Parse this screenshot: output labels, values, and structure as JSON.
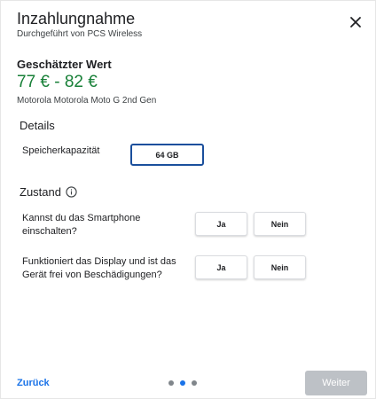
{
  "header": {
    "title": "Inzahlungnahme",
    "subtitle": "Durchgeführt von PCS Wireless"
  },
  "estimate": {
    "label": "Geschätzter Wert",
    "value": "77 € - 82 €",
    "device": "Motorola Motorola Moto G 2nd Gen"
  },
  "details": {
    "title": "Details",
    "storage_label": "Speicherkapazität",
    "storage_value": "64 GB"
  },
  "condition": {
    "title": "Zustand",
    "questions": [
      {
        "label": "Kannst du das Smartphone einschalten?",
        "yes": "Ja",
        "no": "Nein"
      },
      {
        "label": "Funktioniert das Display und ist das Gerät frei von Beschädigungen?",
        "yes": "Ja",
        "no": "Nein"
      }
    ]
  },
  "footer": {
    "back_label": "Zurück",
    "next_label": "Weiter",
    "steps_total": 3,
    "current_step": 2
  },
  "colors": {
    "price": "#188038",
    "accent": "#1a73e8",
    "selected_border": "#1a4f9c",
    "disabled_button": "#bdc1c6"
  },
  "icons": {
    "close": "close-icon",
    "info": "info-icon"
  }
}
